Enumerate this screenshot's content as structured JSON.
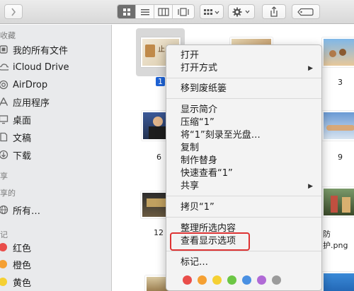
{
  "toolbar": {
    "view_modes": [
      "icon-view",
      "list-view",
      "column-view",
      "cover-flow-view"
    ]
  },
  "sidebar": {
    "sections": [
      {
        "label": "收藏"
      },
      {
        "label": "共享的"
      },
      {
        "label": "标记"
      }
    ],
    "favorites": [
      {
        "label": "我的所有文件",
        "icon": "all-files-icon"
      },
      {
        "label": "iCloud Drive",
        "icon": "cloud-icon"
      },
      {
        "label": "AirDrop",
        "icon": "airdrop-icon"
      },
      {
        "label": "应用程序",
        "icon": "applications-icon"
      },
      {
        "label": "桌面",
        "icon": "desktop-icon"
      },
      {
        "label": "文稿",
        "icon": "documents-icon"
      },
      {
        "label": "下载",
        "icon": "downloads-icon"
      }
    ],
    "shared": [
      {
        "label": "所有…",
        "icon": "network-icon"
      }
    ],
    "tags": [
      {
        "label": "红色",
        "color": "#e94d4a"
      },
      {
        "label": "橙色",
        "color": "#f5a033"
      },
      {
        "label": "黄色",
        "color": "#f5d033"
      }
    ],
    "sections_visible": [
      "收藏",
      "享的",
      "记"
    ]
  },
  "files": [
    {
      "label": "1",
      "selected": true
    },
    {
      "label": ""
    },
    {
      "label": "3"
    },
    {
      "label": "6"
    },
    {
      "label": "9"
    },
    {
      "label": "12"
    },
    {
      "label": "防护.png"
    }
  ],
  "context_menu": {
    "items": [
      {
        "label": "打开"
      },
      {
        "label": "打开方式",
        "submenu": true
      },
      {
        "label": "移到废纸篓"
      },
      {
        "label": "显示简介"
      },
      {
        "label": "压缩“1”"
      },
      {
        "label": "将“1”刻录至光盘…"
      },
      {
        "label": "复制"
      },
      {
        "label": "制作替身"
      },
      {
        "label": "快速查看“1”"
      },
      {
        "label": "共享",
        "submenu": true
      },
      {
        "label": "拷贝“1”"
      },
      {
        "label": "整理所选内容"
      },
      {
        "label": "查看显示选项"
      },
      {
        "label": "标记…"
      }
    ],
    "tag_colors": [
      "#e94d4a",
      "#f5a033",
      "#f5d033",
      "#6cc644",
      "#4a90e2",
      "#b06ad6",
      "#9b9b9b"
    ],
    "highlight_color": "#d33333"
  }
}
